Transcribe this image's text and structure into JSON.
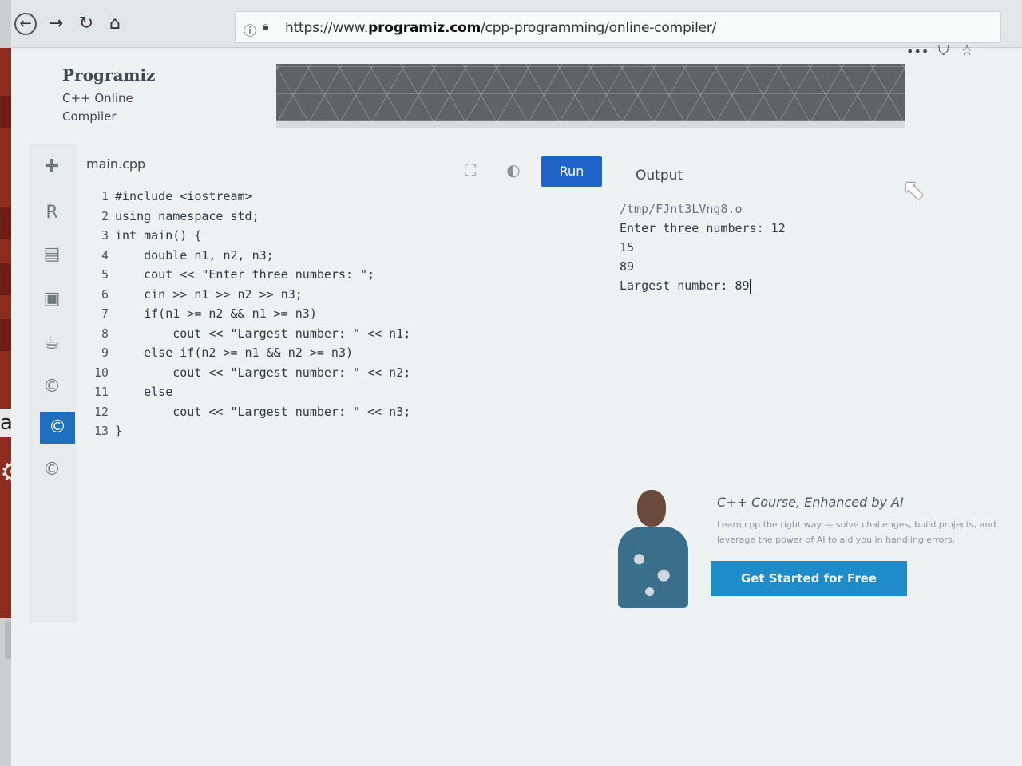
{
  "browser": {
    "url_prefix": "https://www.",
    "url_domain": "programiz.com",
    "url_path": "/cpp-programming/online-compiler/"
  },
  "header": {
    "logo": "Programiz",
    "subtitle_line1": "C++ Online",
    "subtitle_line2": "Compiler"
  },
  "editor": {
    "file_name": "main.cpp",
    "run_label": "Run",
    "lines": [
      {
        "num": "1",
        "code": "#include <iostream>"
      },
      {
        "num": "2",
        "code": "using namespace std;"
      },
      {
        "num": "3",
        "code": "int main() {"
      },
      {
        "num": "4",
        "code": "    double n1, n2, n3;"
      },
      {
        "num": "5",
        "code": "    cout << \"Enter three numbers: \";"
      },
      {
        "num": "6",
        "code": "    cin >> n1 >> n2 >> n3;"
      },
      {
        "num": "7",
        "code": "    if(n1 >= n2 && n1 >= n3)"
      },
      {
        "num": "8",
        "code": "        cout << \"Largest number: \" << n1;"
      },
      {
        "num": "9",
        "code": "    else if(n2 >= n1 && n2 >= n3)"
      },
      {
        "num": "10",
        "code": "        cout << \"Largest number: \" << n2;"
      },
      {
        "num": "11",
        "code": "    else"
      },
      {
        "num": "12",
        "code": "        cout << \"Largest number: \" << n3;"
      },
      {
        "num": "13",
        "code": "}"
      }
    ]
  },
  "output": {
    "label": "Output",
    "lines": [
      "/tmp/FJnt3LVng8.o",
      "Enter three numbers: 12",
      "15",
      "89",
      "Largest number: 89"
    ]
  },
  "ad": {
    "title": "C++ Course, Enhanced by AI",
    "desc_line1": "Learn cpp the right way — solve challenges, build projects, and",
    "desc_line2": "leverage the power of AI to aid you in handling errors.",
    "cta": "Get Started for Free"
  },
  "colors": {
    "run_button": "#1e63c8",
    "cta_button": "#1e8cc8",
    "active_side_icon": "#1f6fbf"
  }
}
